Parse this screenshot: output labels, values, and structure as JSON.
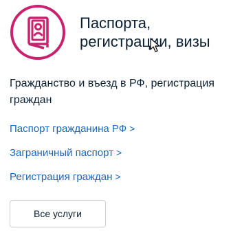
{
  "category": {
    "icon": "passport-icon",
    "title_line1": "Паспорта,",
    "title_line2": "регистрации, визы",
    "description": "Гражданство и въезд в РФ, регистрация граждан"
  },
  "links": [
    {
      "label": "Паспорт гражданина РФ",
      "chevron": ">"
    },
    {
      "label": "Заграничный паспорт",
      "chevron": ">"
    },
    {
      "label": "Регистрация граждан",
      "chevron": ">"
    }
  ],
  "all_services_button": {
    "label": "Все услуги"
  },
  "colors": {
    "accent_icon": "#c8226f",
    "link": "#1a66b8",
    "text": "#0b1f33",
    "button_border": "#c9ced6"
  }
}
